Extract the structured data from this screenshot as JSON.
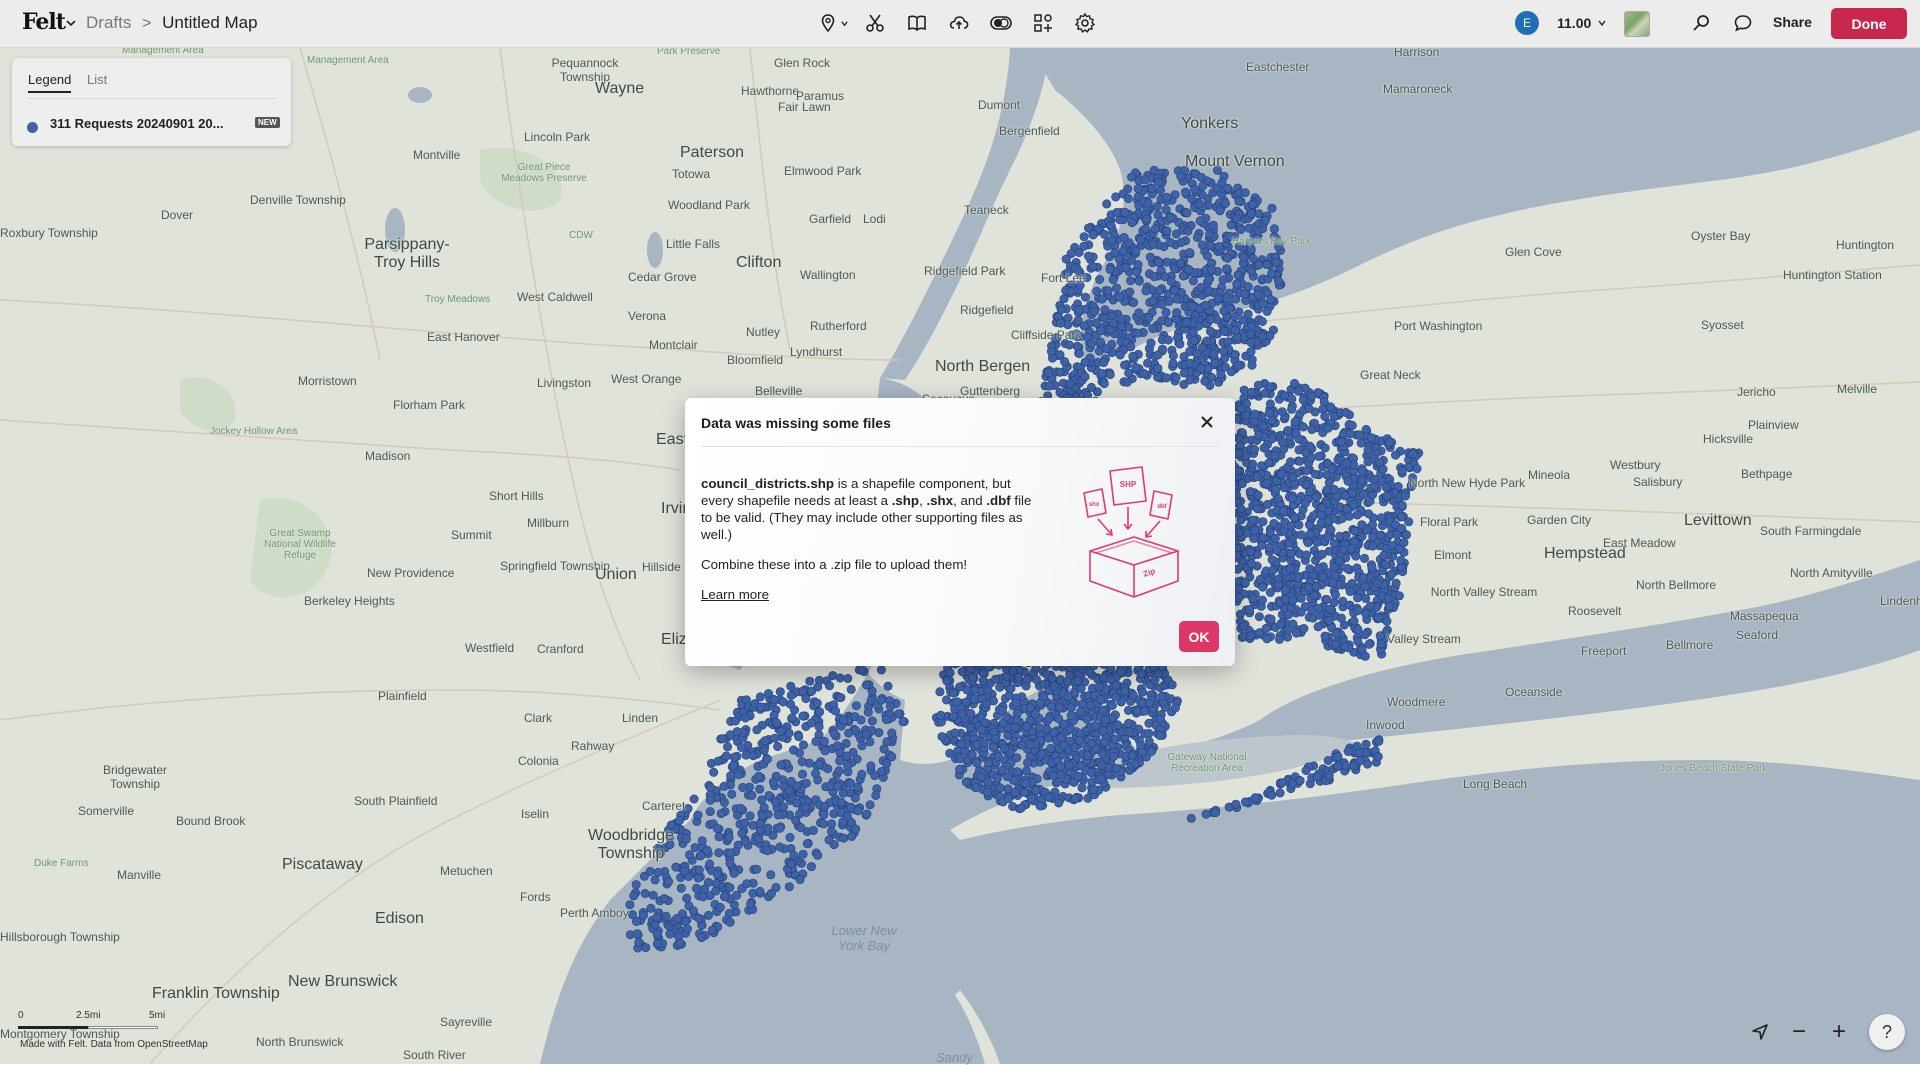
{
  "topbar": {
    "logo": "Felt",
    "breadcrumb_drafts": "Drafts",
    "breadcrumb_separator": ">",
    "map_title": "Untitled Map",
    "tools": [
      "pin-icon",
      "scissors-icon",
      "book-icon",
      "upload-icon",
      "toggle-icon",
      "elements-icon",
      "gear-icon"
    ],
    "avatar_initial": "E",
    "zoom_level": "11.00",
    "share_label": "Share",
    "done_label": "Done",
    "accent_color": "#c8284d"
  },
  "legend": {
    "tabs": [
      "Legend",
      "List"
    ],
    "active_tab": "Legend",
    "layer_name": "311 Requests 20240901 20...",
    "layer_badge": "NEW",
    "layer_color": "#3f62a6"
  },
  "modal": {
    "title": "Data was missing some files",
    "filename": "council_districts.shp",
    "text_1": " is a shapefile component, but every shapefile needs at least a ",
    "ext_shp": ".shp",
    "text_2": ", ",
    "ext_shx": ".shx",
    "text_3": ", and ",
    "ext_dbf": ".dbf",
    "text_4": " file to be valid. (They may include other supporting files as well.)",
    "combine_text": "Combine these into a .zip file to upload them!",
    "learn_more": "Learn more",
    "ok_label": "OK",
    "illustration_labels": [
      "SHP",
      "shx",
      "dbf",
      "Zip"
    ],
    "ok_color": "#dd3768"
  },
  "map": {
    "places": [
      {
        "name": "Management Area",
        "cls": "park"
      },
      {
        "name": "Management Area",
        "cls": "park"
      },
      {
        "name": "Pequannock Township",
        "cls": ""
      },
      {
        "name": "Park Preserve",
        "cls": "park"
      },
      {
        "name": "Glen Rock",
        "cls": ""
      },
      {
        "name": "Harrison",
        "cls": ""
      },
      {
        "name": "Eastchester",
        "cls": ""
      },
      {
        "name": "Wayne",
        "cls": "big"
      },
      {
        "name": "Hawthorne",
        "cls": ""
      },
      {
        "name": "Paramus",
        "cls": ""
      },
      {
        "name": "Mamaroneck",
        "cls": ""
      },
      {
        "name": "Fair Lawn",
        "cls": ""
      },
      {
        "name": "Dumont",
        "cls": ""
      },
      {
        "name": "Bergenfield",
        "cls": ""
      },
      {
        "name": "Yonkers",
        "cls": "big"
      },
      {
        "name": "Lincoln Park",
        "cls": ""
      },
      {
        "name": "Montville",
        "cls": ""
      },
      {
        "name": "Paterson",
        "cls": "big"
      },
      {
        "name": "Elmwood Park",
        "cls": ""
      },
      {
        "name": "Mount Vernon",
        "cls": "big"
      },
      {
        "name": "Great Piece Meadows Preserve",
        "cls": "park"
      },
      {
        "name": "Totowa",
        "cls": ""
      },
      {
        "name": "Denville Township",
        "cls": ""
      },
      {
        "name": "Woodland Park",
        "cls": ""
      },
      {
        "name": "Dover",
        "cls": ""
      },
      {
        "name": "Garfield",
        "cls": ""
      },
      {
        "name": "Lodi",
        "cls": ""
      },
      {
        "name": "Teaneck",
        "cls": ""
      },
      {
        "name": "Oyster Bay",
        "cls": ""
      },
      {
        "name": "Roxbury Township",
        "cls": ""
      },
      {
        "name": "Parsippany-Troy Hills",
        "cls": "big"
      },
      {
        "name": "CDW",
        "cls": "park"
      },
      {
        "name": "Little Falls",
        "cls": ""
      },
      {
        "name": "Clifton",
        "cls": "big"
      },
      {
        "name": "Glen Cove",
        "cls": ""
      },
      {
        "name": "Huntington",
        "cls": ""
      },
      {
        "name": "Cedar Grove",
        "cls": ""
      },
      {
        "name": "Wallington",
        "cls": ""
      },
      {
        "name": "Ridgefield Park",
        "cls": ""
      },
      {
        "name": "Fort Lee",
        "cls": ""
      },
      {
        "name": "Huntington Station",
        "cls": ""
      },
      {
        "name": "Troy Meadows",
        "cls": "park"
      },
      {
        "name": "West Caldwell",
        "cls": ""
      },
      {
        "name": "Verona",
        "cls": ""
      },
      {
        "name": "Rutherford",
        "cls": ""
      },
      {
        "name": "Ridgefield",
        "cls": ""
      },
      {
        "name": "Port Washington",
        "cls": ""
      },
      {
        "name": "Syosset",
        "cls": ""
      },
      {
        "name": "East Hanover",
        "cls": ""
      },
      {
        "name": "Montclair",
        "cls": ""
      },
      {
        "name": "Nutley",
        "cls": ""
      },
      {
        "name": "Cliffside Park",
        "cls": ""
      },
      {
        "name": "Lyndhurst",
        "cls": ""
      },
      {
        "name": "Bloomfield",
        "cls": ""
      },
      {
        "name": "North Bergen",
        "cls": "big"
      },
      {
        "name": "Great Neck",
        "cls": ""
      },
      {
        "name": "Morristown",
        "cls": ""
      },
      {
        "name": "Livingston",
        "cls": ""
      },
      {
        "name": "West Orange",
        "cls": ""
      },
      {
        "name": "Guttenberg",
        "cls": ""
      },
      {
        "name": "Jericho",
        "cls": ""
      },
      {
        "name": "Melville",
        "cls": ""
      },
      {
        "name": "Florham Park",
        "cls": ""
      },
      {
        "name": "Belleville",
        "cls": ""
      },
      {
        "name": "Secaucus",
        "cls": ""
      },
      {
        "name": "Plainview",
        "cls": ""
      },
      {
        "name": "Jockey Hollow Area",
        "cls": "park"
      },
      {
        "name": "Hicksville",
        "cls": ""
      },
      {
        "name": "Madison",
        "cls": ""
      },
      {
        "name": "East",
        "cls": "big"
      },
      {
        "name": "North New Hyde Park",
        "cls": ""
      },
      {
        "name": "Mineola",
        "cls": ""
      },
      {
        "name": "Westbury",
        "cls": ""
      },
      {
        "name": "Bethpage",
        "cls": ""
      },
      {
        "name": "Salisbury",
        "cls": ""
      },
      {
        "name": "Short Hills",
        "cls": ""
      },
      {
        "name": "Irvington",
        "cls": "big"
      },
      {
        "name": "Floral Park",
        "cls": ""
      },
      {
        "name": "Garden City",
        "cls": ""
      },
      {
        "name": "Levittown",
        "cls": "big"
      },
      {
        "name": "Millburn",
        "cls": ""
      },
      {
        "name": "Summit",
        "cls": ""
      },
      {
        "name": "Great Swamp National Wildlife Refuge",
        "cls": "park"
      },
      {
        "name": "South Farmingdale",
        "cls": ""
      },
      {
        "name": "East Meadow",
        "cls": ""
      },
      {
        "name": "Hempstead",
        "cls": "big"
      },
      {
        "name": "Elmont",
        "cls": ""
      },
      {
        "name": "Springfield Township",
        "cls": ""
      },
      {
        "name": "New Providence",
        "cls": ""
      },
      {
        "name": "Union",
        "cls": "big"
      },
      {
        "name": "Hillside",
        "cls": ""
      },
      {
        "name": "North Amityville",
        "cls": ""
      },
      {
        "name": "North Bellmore",
        "cls": ""
      },
      {
        "name": "North Valley Stream",
        "cls": ""
      },
      {
        "name": "Berkeley Heights",
        "cls": ""
      },
      {
        "name": "Lindenh",
        "cls": ""
      },
      {
        "name": "Roosevelt",
        "cls": ""
      },
      {
        "name": "Massapequa",
        "cls": ""
      },
      {
        "name": "Westfield",
        "cls": ""
      },
      {
        "name": "Cranford",
        "cls": ""
      },
      {
        "name": "Eliz",
        "cls": "big"
      },
      {
        "name": "Valley Stream",
        "cls": ""
      },
      {
        "name": "Seaford",
        "cls": ""
      },
      {
        "name": "Bellmore",
        "cls": ""
      },
      {
        "name": "Freeport",
        "cls": ""
      },
      {
        "name": "Oceanside",
        "cls": ""
      },
      {
        "name": "Plainfield",
        "cls": ""
      },
      {
        "name": "Woodmere",
        "cls": ""
      },
      {
        "name": "Clark",
        "cls": ""
      },
      {
        "name": "Linden",
        "cls": ""
      },
      {
        "name": "Inwood",
        "cls": ""
      },
      {
        "name": "Rahway",
        "cls": ""
      },
      {
        "name": "Bridgewater Township",
        "cls": ""
      },
      {
        "name": "Colonia",
        "cls": ""
      },
      {
        "name": "Gateway National Recreation Area",
        "cls": "park"
      },
      {
        "name": "Jones Beach State Park",
        "cls": "park"
      },
      {
        "name": "Long Beach",
        "cls": ""
      },
      {
        "name": "South Plainfield",
        "cls": ""
      },
      {
        "name": "Carteret",
        "cls": ""
      },
      {
        "name": "Somerville",
        "cls": ""
      },
      {
        "name": "Bound Brook",
        "cls": ""
      },
      {
        "name": "Iselin",
        "cls": ""
      },
      {
        "name": "Woodbridge Township",
        "cls": "big"
      },
      {
        "name": "Duke Farms",
        "cls": "park"
      },
      {
        "name": "Piscataway",
        "cls": "big"
      },
      {
        "name": "Manville",
        "cls": ""
      },
      {
        "name": "Metuchen",
        "cls": ""
      },
      {
        "name": "Fords",
        "cls": ""
      },
      {
        "name": "Perth Amboy",
        "cls": ""
      },
      {
        "name": "Edison",
        "cls": "big"
      },
      {
        "name": "Lower New York Bay",
        "cls": "water"
      },
      {
        "name": "Hillsborough Township",
        "cls": ""
      },
      {
        "name": "Franklin Township",
        "cls": "big"
      },
      {
        "name": "New Brunswick",
        "cls": "big"
      },
      {
        "name": "Sayreville",
        "cls": ""
      },
      {
        "name": "Montgomery Township",
        "cls": ""
      },
      {
        "name": "North Brunswick",
        "cls": ""
      },
      {
        "name": "South River",
        "cls": ""
      },
      {
        "name": "Sandy",
        "cls": "water"
      },
      {
        "name": "Harpers Bay Park",
        "cls": "park"
      }
    ],
    "scale_labels": [
      "0",
      "2.5mi",
      "5mi"
    ],
    "attribution": "Made with Felt. Data from OpenStreetMap",
    "land_color": "#dfe3da",
    "water_color": "#a8b5c3",
    "point_color": "#3f62a6"
  },
  "controls": {
    "locate_icon": "locate-arrow-icon",
    "zoom_out": "−",
    "zoom_in": "+",
    "help": "?"
  }
}
